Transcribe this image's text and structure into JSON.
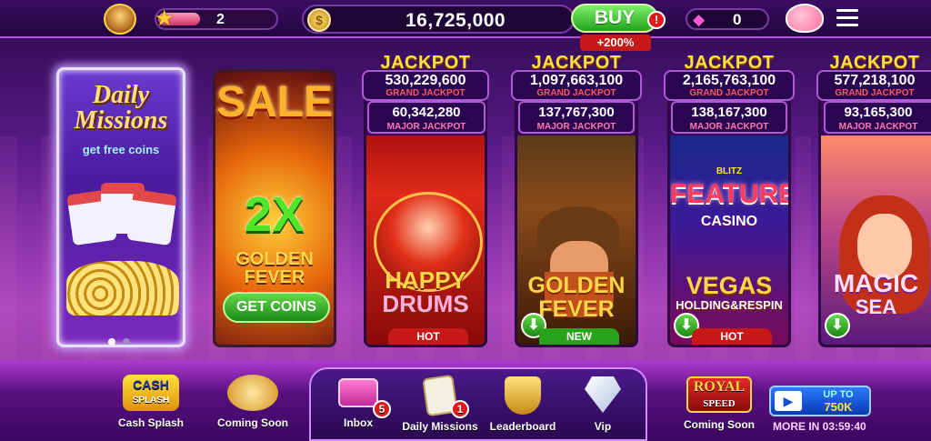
{
  "topbar": {
    "level": "2",
    "coins": "16,725,000",
    "buy_label": "BUY",
    "buy_badge": "!",
    "buy_bonus": "+200%",
    "gems": "0",
    "coin_symbol": "$"
  },
  "daily": {
    "title_line1": "Daily",
    "title_line2": "Missions",
    "subtitle": "get free coins",
    "page_indicator": {
      "pages": 2,
      "current": 1
    }
  },
  "sale": {
    "title": "SALE",
    "multiplier": "2X",
    "game_line1": "GOLDEN",
    "game_line2": "FEVER",
    "button": "GET COINS"
  },
  "slots": [
    {
      "jackpot_label": "JACKPOT",
      "grand": "530,229,600",
      "grand_label": "GRAND JACKPOT",
      "major": "60,342,280",
      "major_label": "MAJOR JACKPOT",
      "name_line1": "HAPPY",
      "name_line2": "DRUMS",
      "tag": "HOT"
    },
    {
      "jackpot_label": "JACKPOT",
      "grand": "1,097,663,100",
      "grand_label": "GRAND JACKPOT",
      "major": "137,767,300",
      "major_label": "MAJOR JACKPOT",
      "name_line1": "GOLDEN",
      "name_line2": "FEVER",
      "tag": "NEW"
    },
    {
      "jackpot_label": "JACKPOT",
      "grand": "2,165,763,100",
      "grand_label": "GRAND JACKPOT",
      "major": "138,167,300",
      "major_label": "MAJOR JACKPOT",
      "badge": "BLITZ",
      "feature_line1": "FEATURE",
      "feature_line2": "CASINO",
      "name_line1": "VEGAS",
      "name_line2": "HOLDING&RESPIN",
      "tag": "HOT"
    },
    {
      "jackpot_label": "JACKPOT",
      "grand": "577,218,100",
      "grand_label": "GRAND JACKPOT",
      "major": "93,165,300",
      "major_label": "MAJOR JACKPOT",
      "name_line1": "MAGIC",
      "name_line2": "SEA"
    }
  ],
  "bottom": {
    "cash_splash": {
      "logo_line1": "CASH",
      "logo_line2": "SPLASH",
      "label": "Cash Splash"
    },
    "coming_soon_1": "Coming Soon",
    "inbox": {
      "label": "Inbox",
      "badge": "5"
    },
    "daily_missions": {
      "label": "Daily Missions",
      "badge": "1"
    },
    "leaderboard": "Leaderboard",
    "vip": "Vip",
    "royal_speed": {
      "logo_line1": "ROYAL",
      "logo_line2": "SPEED",
      "label": "Coming Soon"
    },
    "promo": {
      "upto": "UP TO",
      "amount": "750K",
      "timer": "MORE IN 03:59:40"
    }
  },
  "colors": {
    "accent": "#b05ad8",
    "gold": "#ffe23a",
    "green": "#1fa21a",
    "red": "#e01818"
  }
}
